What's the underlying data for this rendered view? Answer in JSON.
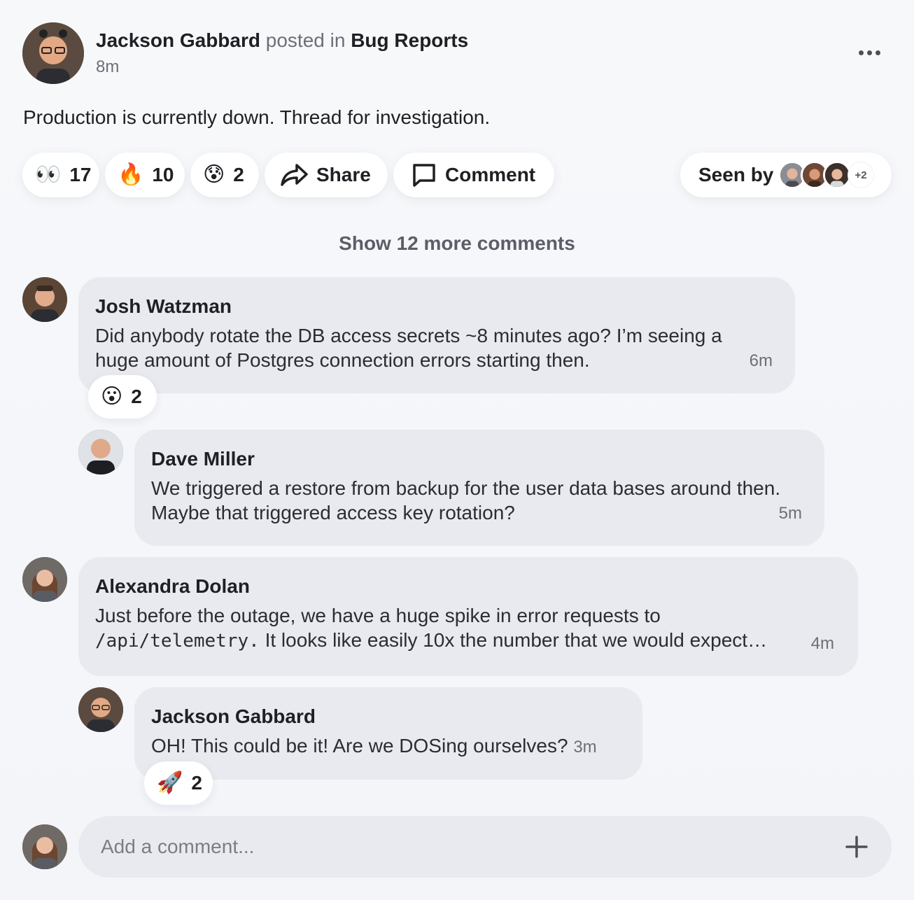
{
  "post": {
    "author": "Jackson Gabbard",
    "posted_in": "posted in",
    "channel": "Bug Reports",
    "time": "8m",
    "body": "Production is currently down. Thread for investigation."
  },
  "reactions": [
    {
      "emoji": "👀",
      "count": "17"
    },
    {
      "emoji": "🔥",
      "count": "10"
    },
    {
      "emoji": "😰",
      "count": "2"
    }
  ],
  "actions": {
    "share_label": "Share",
    "comment_label": "Comment",
    "seen_by_label": "Seen by",
    "seen_by_more": "+2"
  },
  "show_more_label": "Show 12 more comments",
  "comments": [
    {
      "author": "Josh Watzman",
      "text": "Did anybody rotate the DB access secrets ~8 minutes ago? I’m seeing a huge amount of Postgres connection errors starting then.",
      "time": "6m",
      "reaction": {
        "emoji": "😮",
        "count": "2"
      }
    },
    {
      "author": "Dave Miller",
      "text": "We triggered a restore from backup for the user data bases around then. Maybe that triggered access key rotation?",
      "time": "5m"
    },
    {
      "author": "Alexandra Dolan",
      "text_line1": "Just before the outage, we have a huge spike in error requests to",
      "code": "/api/telemetry.",
      "text_line2": " It looks like easily 10x the number that we would expect…",
      "time": "4m"
    },
    {
      "author": "Jackson Gabbard",
      "text": "OH! This could be it! Are we DOSing ourselves?",
      "time": "3m",
      "reaction": {
        "emoji": "🚀",
        "count": "2"
      }
    }
  ],
  "composer": {
    "placeholder": "Add a comment..."
  },
  "colors": {
    "background": "#f5f6f9",
    "bubble": "#e9eaef",
    "pill": "#ffffff",
    "text": "#1f2024",
    "muted": "#6c6f78"
  }
}
